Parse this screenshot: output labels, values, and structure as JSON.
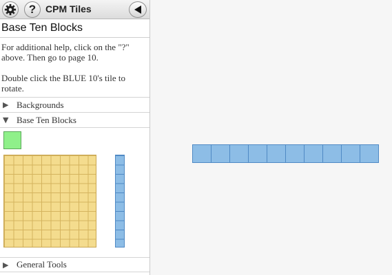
{
  "app": {
    "title": "CPM Tiles"
  },
  "toolbar": {
    "settings_icon": "gear-icon",
    "help_label": "?",
    "back_icon": "triangle-left-icon"
  },
  "panel": {
    "title": "Base Ten Blocks",
    "help_lines": [
      "For additional help, click on the \"?\" above. Then go to page 10.",
      "Double click the BLUE 10's tile to rotate."
    ],
    "sections": [
      {
        "label": "Backgrounds",
        "expanded": false
      },
      {
        "label": "Base Ten Blocks",
        "expanded": true
      },
      {
        "label": "General Tools",
        "expanded": false
      }
    ]
  },
  "tiles": {
    "unit_color": "#8ff08a",
    "hundred_color": "#f4dc8e",
    "ten_color": "#8dbde6"
  }
}
